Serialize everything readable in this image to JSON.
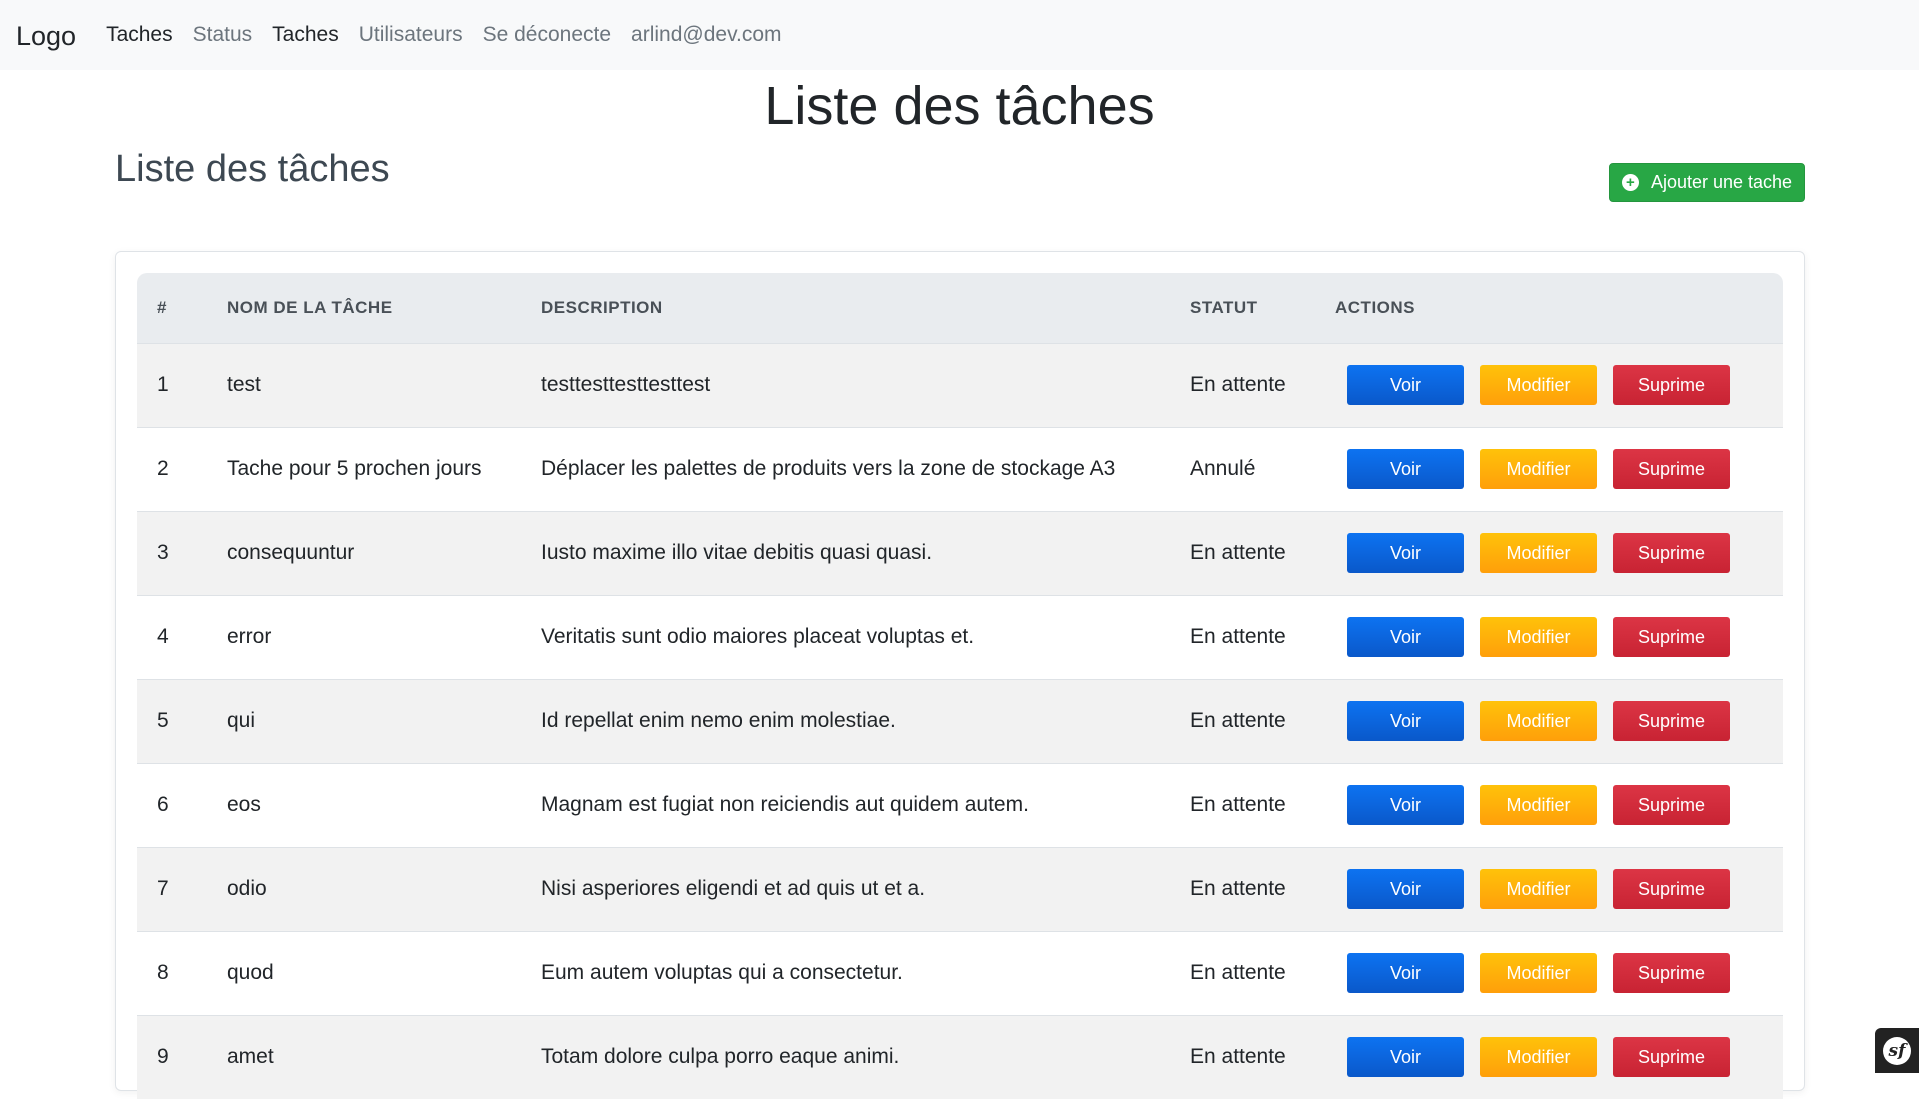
{
  "navbar": {
    "brand": "Logo",
    "links": [
      {
        "label": "Taches",
        "active": true
      },
      {
        "label": "Status",
        "active": false
      },
      {
        "label": "Taches",
        "active": true
      },
      {
        "label": "Utilisateurs",
        "active": false
      },
      {
        "label": "Se déconecte",
        "active": false
      },
      {
        "label": "arlind@dev.com",
        "active": false
      }
    ]
  },
  "page": {
    "title": "Liste des tâches",
    "section_title": "Liste des tâches",
    "add_button_label": "Ajouter une tache",
    "add_button_icon": "plus-circle-icon"
  },
  "table": {
    "headers": [
      "#",
      "NOM DE LA TÂCHE",
      "DESCRIPTION",
      "STATUT",
      "ACTIONS"
    ],
    "action_labels": {
      "view": "Voir",
      "edit": "Modifier",
      "delete": "Suprime"
    },
    "rows": [
      {
        "id": "1",
        "name": "test",
        "description": "testtesttesttesttest",
        "status": "En attente"
      },
      {
        "id": "2",
        "name": "Tache pour 5 prochen jours",
        "description": "Déplacer les palettes de produits vers la zone de stockage A3",
        "status": "Annulé"
      },
      {
        "id": "3",
        "name": "consequuntur",
        "description": "Iusto maxime illo vitae debitis quasi quasi.",
        "status": "En attente"
      },
      {
        "id": "4",
        "name": "error",
        "description": "Veritatis sunt odio maiores placeat voluptas et.",
        "status": "En attente"
      },
      {
        "id": "5",
        "name": "qui",
        "description": "Id repellat enim nemo enim molestiae.",
        "status": "En attente"
      },
      {
        "id": "6",
        "name": "eos",
        "description": "Magnam est fugiat non reiciendis aut quidem autem.",
        "status": "En attente"
      },
      {
        "id": "7",
        "name": "odio",
        "description": "Nisi asperiores eligendi et ad quis ut et a.",
        "status": "En attente"
      },
      {
        "id": "8",
        "name": "quod",
        "description": "Eum autem voluptas qui a consectetur.",
        "status": "En attente"
      },
      {
        "id": "9",
        "name": "amet",
        "description": "Totam dolore culpa porro eaque animi.",
        "status": "En attente"
      }
    ]
  },
  "colors": {
    "navbar_bg": "#f8f9fa",
    "success": "#28a745",
    "primary": "#0d6efd",
    "warning": "#ffc107",
    "danger": "#dc3545"
  },
  "debug_toolbar": {
    "icon": "symfony-logo-icon"
  }
}
